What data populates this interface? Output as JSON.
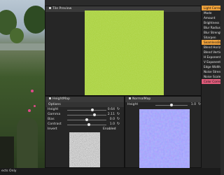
{
  "colors": {
    "accent": "#e8a23a",
    "panel_bg": "#262626",
    "title_bg": "#3a3a3a",
    "grass": "#a9cf3c",
    "normal_map": "#7f7fff",
    "light_correction": "#f0a23b",
    "color_correction": "#e05b7a"
  },
  "panels": {
    "tile_preview": {
      "title": "Tile Preview"
    },
    "heightmap": {
      "title": "HeightMap",
      "options_label": "Options",
      "params": [
        {
          "label": "Height",
          "value": "0.64",
          "fraction": 0.64
        },
        {
          "label": "Gamma",
          "value": "2.11",
          "fraction": 0.7
        },
        {
          "label": "Bias",
          "value": "0.0",
          "fraction": 0.5
        },
        {
          "label": "Contrast",
          "value": "1.0",
          "fraction": 0.55
        }
      ],
      "invert_label": "Invert",
      "invert_value": "Enabled"
    },
    "normalmap": {
      "title": "NormalMap",
      "height_label": "Height",
      "height_value": "1.0",
      "height_fraction": 0.5
    }
  },
  "sidebar": {
    "light_correction": "Light Correct",
    "light_items": [
      "Mode",
      "Amount",
      "Brightness",
      "Blur Radius",
      "Blur Strength",
      "Sharpen"
    ],
    "seamless": "SeamlessBorder",
    "seamless_items": [
      "Blend Horizontal",
      "Blend Vertical",
      "H Exponent",
      "V Exponent",
      "Edge Width",
      "Noise Strength",
      "Noise Scale"
    ],
    "color_correction": "Color Correct"
  },
  "status": {
    "text": "ects Only"
  }
}
